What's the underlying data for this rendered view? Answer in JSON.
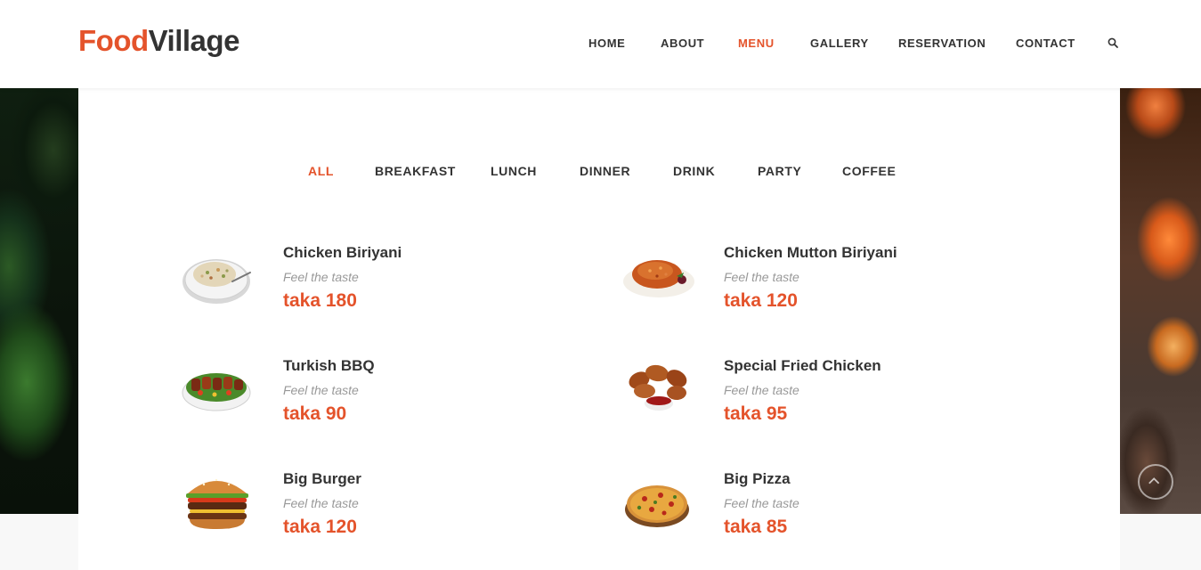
{
  "brand": {
    "part1": "Food",
    "part2": "Village"
  },
  "nav": {
    "items": [
      {
        "label": "HOME"
      },
      {
        "label": "ABOUT"
      },
      {
        "label": "MENU"
      },
      {
        "label": "GALLERY"
      },
      {
        "label": "RESERVATION"
      },
      {
        "label": "CONTACT"
      }
    ],
    "active_index": 2,
    "search_icon": "search-icon"
  },
  "filters": {
    "items": [
      {
        "label": "ALL"
      },
      {
        "label": "BREAKFAST"
      },
      {
        "label": "LUNCH"
      },
      {
        "label": "DINNER"
      },
      {
        "label": "DRINK"
      },
      {
        "label": "PARTY"
      },
      {
        "label": "COFFEE"
      }
    ],
    "active_index": 0
  },
  "menu_items": [
    {
      "name": "Chicken Biriyani",
      "tagline": "Feel the taste",
      "price": "taka 180",
      "image": "rice-plate"
    },
    {
      "name": "Chicken Mutton Biriyani",
      "tagline": "Feel the taste",
      "price": "taka 120",
      "image": "biriyani-plate"
    },
    {
      "name": "Turkish BBQ",
      "tagline": "Feel the taste",
      "price": "taka 90",
      "image": "bbq-plate"
    },
    {
      "name": "Special Fried Chicken",
      "tagline": "Feel the taste",
      "price": "taka 95",
      "image": "fried-chicken"
    },
    {
      "name": "Big Burger",
      "tagline": "Feel the taste",
      "price": "taka 120",
      "image": "burger"
    },
    {
      "name": "Big Pizza",
      "tagline": "Feel the taste",
      "price": "taka 85",
      "image": "pizza"
    }
  ],
  "colors": {
    "accent": "#e4532b",
    "text": "#333333",
    "muted": "#999999"
  }
}
